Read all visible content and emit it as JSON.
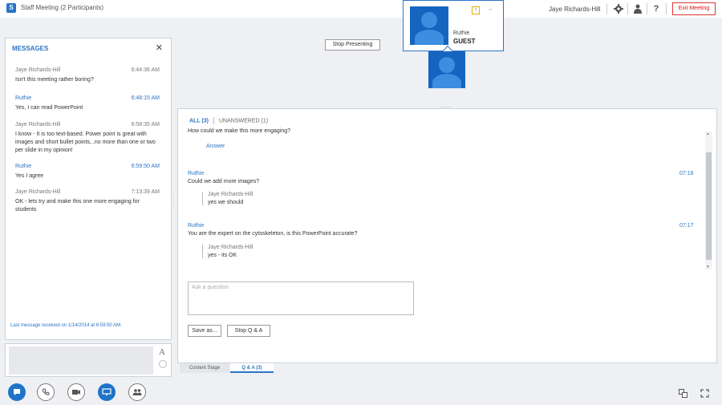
{
  "titlebar": {
    "app_icon": "S",
    "title": "Staff Meeting (2 Participants)",
    "presenter_name": "Jaye Richards-Hill",
    "icons": {
      "settings": "gear-icon",
      "status": "person-icon",
      "help": "?"
    },
    "exit_label": "Exit Meeting"
  },
  "stage": {
    "stop_presenting_label": "Stop Presenting",
    "popup": {
      "name": "Ruthie",
      "role": "GUEST",
      "upload_icon": "↑",
      "dash": "–"
    },
    "resize_handle": "....."
  },
  "messages": {
    "header": "MESSAGES",
    "close": "✕",
    "items": [
      {
        "sender": "Jaye Richards-Hill",
        "time": "6:44:36 AM",
        "text": "Isn't this meeting rather boring?"
      },
      {
        "sender": "Ruthie",
        "time": "6:48:15 AM",
        "text": "Yes, I can read PowerPoint"
      },
      {
        "sender": "Jaye Richards-Hill",
        "time": "6:58:35 AM",
        "text": "I know - It is too text-based. Power point is great with images and short bullet points...no more than one or two per slide in my opinion!"
      },
      {
        "sender": "Ruthie",
        "time": "6:59:50 AM",
        "text": "Yes I agree"
      },
      {
        "sender": "Jaye Richards-Hill",
        "time": "7:13:39 AM",
        "text": "OK - lets try and make this one more engaging for students"
      }
    ],
    "last_received": "Last message received on 1/14/2014 at 6:59:50 AM.",
    "compose_font_glyph": "A"
  },
  "qa": {
    "tab_all": "ALL (3)",
    "tab_unanswered": "UNANSWERED (1)",
    "first_question": "How could we make this more engaging?",
    "answer_link": "Answer",
    "threads": [
      {
        "asker": "Ruthie",
        "time": "07:16",
        "question": "Could we add more images?",
        "reply_author": "Jaye Richards-Hill",
        "reply_text": "yes we should"
      },
      {
        "asker": "Ruthie",
        "time": "07:17",
        "question": "You are the expert on the cytoskeleton, is this PowerPoint accurate?",
        "reply_author": "Jaye Richards-Hill",
        "reply_text": "yes - its OK"
      }
    ],
    "ask_placeholder": "Ask a question",
    "save_label": "Save as...",
    "stop_label": "Stop Q & A"
  },
  "bottom_tabs": {
    "content_stage": "Content Stage",
    "qa_tab": "Q & A   (3)"
  },
  "bottom_bar": {
    "icons": [
      "chat-icon",
      "phone-icon",
      "video-icon",
      "present-icon",
      "participants-icon"
    ],
    "right_icons": [
      "layout-icon",
      "fullscreen-icon"
    ]
  },
  "colors": {
    "accent": "#1e74c9",
    "exit": "#dd1111"
  }
}
